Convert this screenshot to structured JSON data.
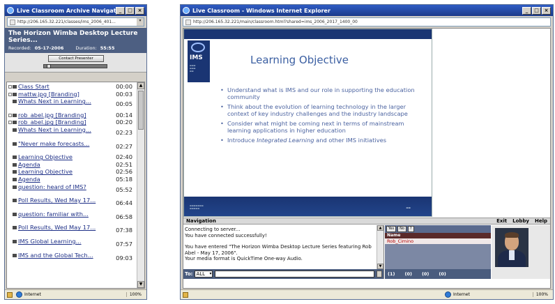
{
  "left_window": {
    "title": "Live Classroom Archive Navigatio...",
    "address": "http://206.165.32.221/classes/ims_2006_401...",
    "presentation_title": "The Horizon Wimba Desktop Lecture Series...",
    "recorded_label": "Recorded:",
    "recorded_value": "05-17-2006",
    "duration_label": "Duration:",
    "duration_value": "55:55",
    "contact_button": "Contact Presenter",
    "toc": [
      {
        "label": "Class Start",
        "time": "00:00"
      },
      {
        "label": "mattw.jpg [Branding]",
        "time": "00:03"
      },
      {
        "label": "Whats Next in Learning...",
        "time": "00:05"
      },
      {
        "label": "rob_abel.jpg [Branding]",
        "time": "00:14"
      },
      {
        "label": "rob_abel.jpg [Branding]",
        "time": "00:20"
      },
      {
        "label": "Whats Next in Learning...",
        "time": "02:23"
      },
      {
        "label": "\"Never make forecasts...",
        "time": "02:27"
      },
      {
        "label": "Learning Objective",
        "time": "02:40"
      },
      {
        "label": "Agenda",
        "time": "02:51"
      },
      {
        "label": "Learning Objective",
        "time": "02:56"
      },
      {
        "label": "Agenda",
        "time": "05:18"
      },
      {
        "label": "question: heard of IMS?",
        "time": "05:52"
      },
      {
        "label": "Poll Results, Wed May 17...",
        "time": "06:44"
      },
      {
        "label": "question: familiar with...",
        "time": "06:58"
      },
      {
        "label": "Poll Results, Wed May 17...",
        "time": "07:38"
      },
      {
        "label": "IMS Global Learning...",
        "time": "07:57"
      },
      {
        "label": "IMS and the Global Tech...",
        "time": "09:03"
      }
    ],
    "status": {
      "zone": "Internet",
      "zoom": "100%"
    }
  },
  "right_window": {
    "title": "Live Classroom - Windows Internet Explorer",
    "address": "http://206.165.32.221/main/classroom.html?shared=ims_2006_2017_1400_00",
    "slide": {
      "logo": "IMS",
      "title": "Learning Objective",
      "bullets": [
        "Understand what is IMS and our role in supporting the education community",
        "Think about the evolution of learning technology in the larger context of key industry challenges and the industry landscape",
        "Consider what might be coming next in terms of mainstream learning applications in higher education"
      ],
      "bullet4_pre": "Introduce ",
      "bullet4_em": "Integrated Learning",
      "bullet4_post": " and other IMS initiatives"
    },
    "nav": {
      "label": "Navigation",
      "exit": "Exit",
      "lobby": "Lobby",
      "help": "Help"
    },
    "chat": {
      "messages": [
        "Connecting to server...",
        "You have connected successfully!",
        "You have entered \"The Horizon Wimba Desktop Lecture Series featuring Rob Abel - May 17, 2006\".",
        "Your media format is QuickTime One-way Audio."
      ],
      "to_label": "To:",
      "to_value": "ALL"
    },
    "participants": {
      "toolbar": [
        "Yes",
        "No",
        "?"
      ],
      "header": "Name",
      "user": "Rob_Cimino",
      "counts": [
        "(1)",
        "(0)",
        "(0)",
        "(0)"
      ]
    },
    "status": {
      "zone": "Internet",
      "zoom": "100%"
    }
  }
}
